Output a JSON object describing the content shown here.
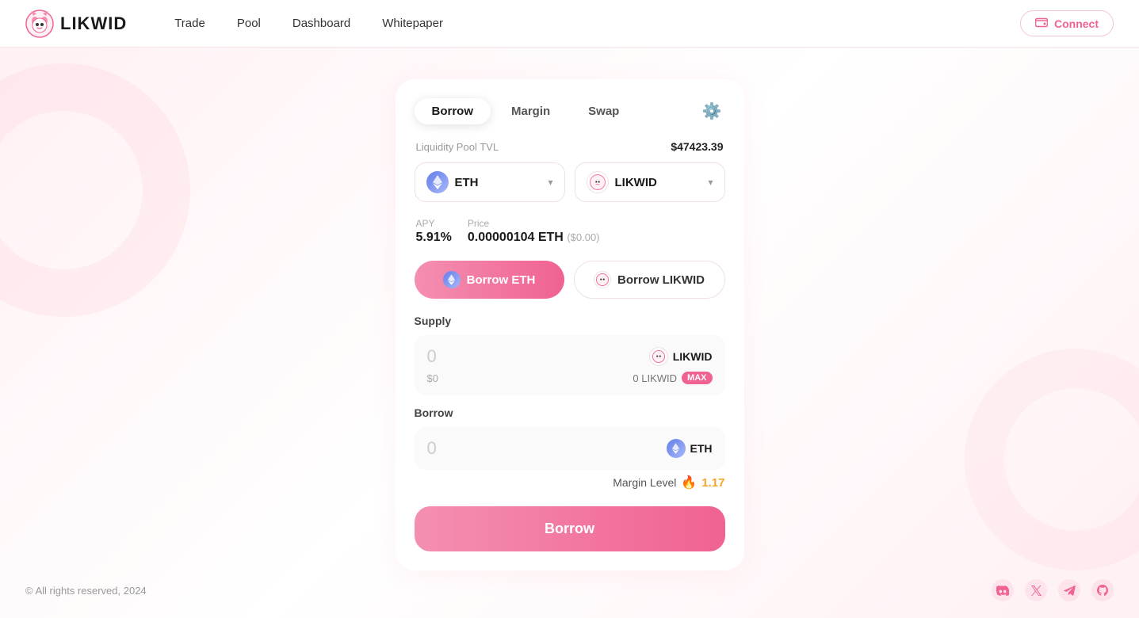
{
  "brand": {
    "name": "LIKWID",
    "logo_alt": "LIKWID logo"
  },
  "nav": {
    "links": [
      "Trade",
      "Pool",
      "Dashboard",
      "Whitepaper"
    ],
    "connect_label": "Connect"
  },
  "tabs": {
    "items": [
      "Borrow",
      "Margin",
      "Swap"
    ],
    "active": "Borrow",
    "settings_icon": "⚙"
  },
  "pool": {
    "label": "Liquidity Pool TVL",
    "value": "$47423.39"
  },
  "token_selectors": [
    {
      "symbol": "ETH",
      "type": "eth"
    },
    {
      "symbol": "LIKWID",
      "type": "likwid"
    }
  ],
  "stats": {
    "apy_label": "APY",
    "apy_value": "5.91%",
    "price_label": "Price",
    "price_value": "0.00000104 ETH",
    "price_usd": "($0.00)"
  },
  "borrow_buttons": {
    "active_label": "Borrow ETH",
    "inactive_label": "Borrow LIKWID"
  },
  "supply": {
    "section_label": "Supply",
    "amount": "0",
    "usd": "$0",
    "token": "LIKWID",
    "balance": "0 LIKWID",
    "max_label": "MAX"
  },
  "borrow": {
    "section_label": "Borrow",
    "amount": "0",
    "token": "ETH"
  },
  "margin_level": {
    "label": "Margin Level",
    "value": "1.17"
  },
  "big_button": {
    "label": "Borrow"
  },
  "footer": {
    "copy": "© All rights reserved, 2024",
    "icons": [
      "discord",
      "twitter-x",
      "telegram",
      "github"
    ]
  }
}
